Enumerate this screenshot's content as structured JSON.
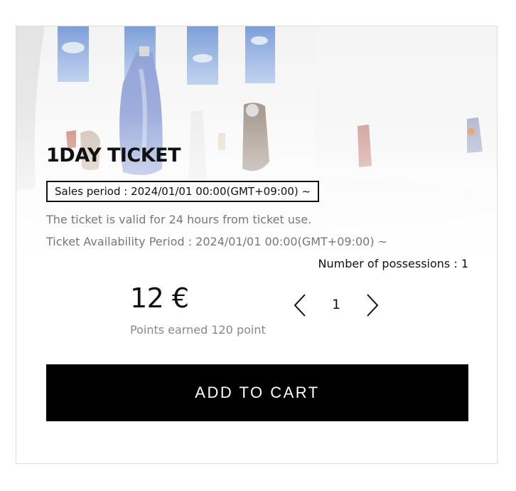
{
  "ticket": {
    "title": "1DAY TICKET",
    "sales_period": "Sales period : 2024/01/01 00:00(GMT+09:00) ~",
    "description": "The ticket is valid for 24 hours from ticket use.",
    "availability": "Ticket Availability Period : 2024/01/01 00:00(GMT+09:00) ~",
    "possessions": "Number of possessions : 1",
    "price": "12 €",
    "points_earned": "Points earned 120 point"
  },
  "quantity": {
    "value": "1",
    "prev_icon": "chevron-left-icon",
    "next_icon": "chevron-right-icon"
  },
  "actions": {
    "add_to_cart": "ADD TO CART"
  },
  "colors": {
    "button_bg": "#000000",
    "button_text": "#ffffff",
    "muted_text": "#777777"
  }
}
